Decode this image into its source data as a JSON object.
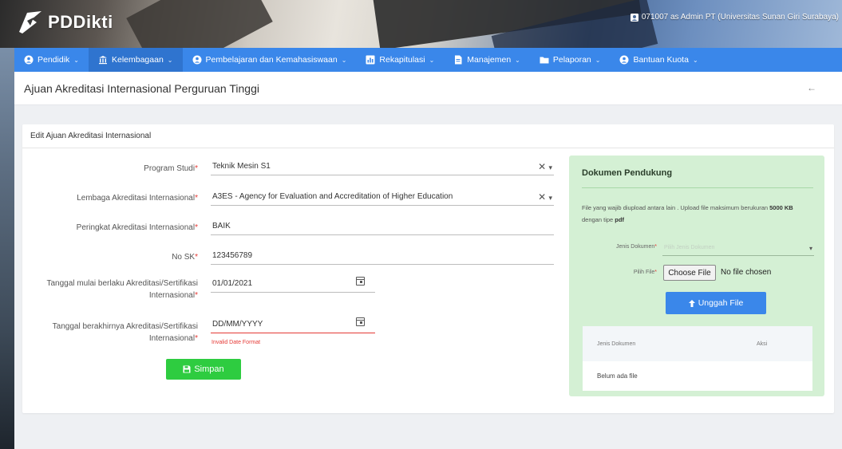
{
  "app": {
    "logo_text": "PDDikti",
    "user": "071007 as Admin PT (Universitas Sunan Giri Surabaya)"
  },
  "nav": {
    "items": [
      {
        "label": "Pendidik",
        "icon": "user-circle-icon"
      },
      {
        "label": "Kelembagaan",
        "icon": "institution-icon"
      },
      {
        "label": "Pembelajaran dan Kemahasiswaan",
        "icon": "user-circle-icon"
      },
      {
        "label": "Rekapitulasi",
        "icon": "chart-icon"
      },
      {
        "label": "Manajemen",
        "icon": "document-icon"
      },
      {
        "label": "Pelaporan",
        "icon": "folder-icon"
      },
      {
        "label": "Bantuan Kuota",
        "icon": "user-circle-icon"
      }
    ],
    "active_index": 1
  },
  "page": {
    "title": "Ajuan Akreditasi Internasional Perguruan Tinggi",
    "back_icon": "arrow-left-icon"
  },
  "form": {
    "header": "Edit Ajuan Akreditasi Internasional",
    "program_studi": {
      "label": "Program Studi",
      "value": "Teknik Mesin S1"
    },
    "lembaga": {
      "label": "Lembaga Akreditasi Internasional",
      "value": "A3ES - Agency for Evaluation and Accreditation of Higher Education"
    },
    "peringkat": {
      "label": "Peringkat Akreditasi Internasional",
      "value": "BAIK"
    },
    "no_sk": {
      "label": "No SK",
      "value": "123456789"
    },
    "tgl_mulai": {
      "label_line1": "Tanggal mulai berlaku Akreditasi/Sertifikasi",
      "label_line2": "Internasional",
      "value": "01/01/2021"
    },
    "tgl_akhir": {
      "label_line1": "Tanggal berakhirnya Akreditasi/Sertifikasi",
      "label_line2": "Internasional",
      "value": "DD/MM/YYYY",
      "error": "Invalid Date Format"
    },
    "required_mark": "*",
    "clear_symbol": "✕",
    "dropdown_symbol": "▾",
    "save_label": "Simpan"
  },
  "docs": {
    "title": "Dokumen Pendukung",
    "desc_part1": "File yang wajib diupload antara lain . Upload file maksimum berukuran ",
    "desc_size": "5000 KB",
    "desc_part2": " dengan tipe ",
    "desc_type": "pdf",
    "jenis_label": "Jenis Dokumen",
    "jenis_placeholder": "Pilih Jenis Dokumen",
    "file_label": "Pilih File",
    "choose_file": "Choose File",
    "no_file": "No file chosen",
    "upload_label": "Unggah File",
    "table_col1": "Jenis Dokumen",
    "table_col2": "Aksi",
    "empty_text": "Belum ada file"
  },
  "colors": {
    "nav": "#3a87ea",
    "save": "#2ecc40",
    "panel": "#d4f0d4",
    "error": "#e53935"
  }
}
